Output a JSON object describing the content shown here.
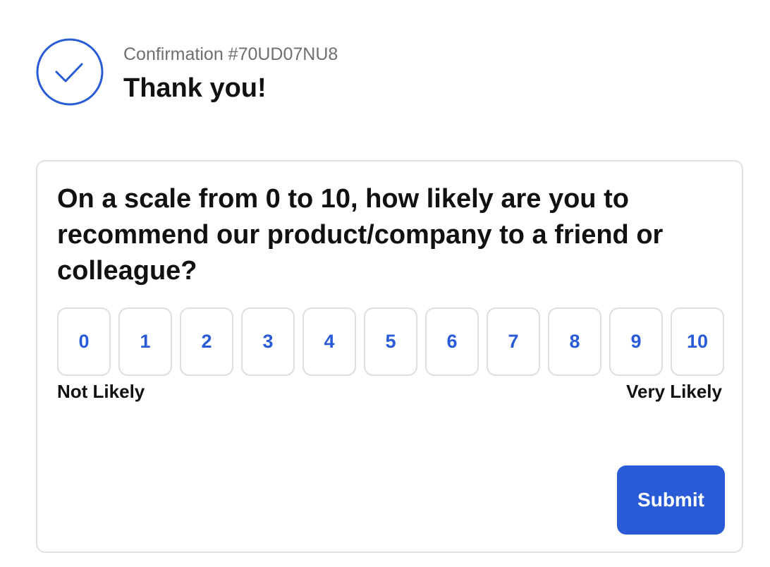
{
  "header": {
    "confirmation": "Confirmation #70UD07NU8",
    "title": "Thank you!",
    "icon": "check-circle-icon",
    "accent_color": "#2a5bd7"
  },
  "survey": {
    "question": "On a scale from 0 to 10, how likely are you to recommend our product/company to a friend or colleague?",
    "options": [
      "0",
      "1",
      "2",
      "3",
      "4",
      "5",
      "6",
      "7",
      "8",
      "9",
      "10"
    ],
    "low_label": "Not Likely",
    "high_label": "Very Likely",
    "submit_label": "Submit"
  }
}
